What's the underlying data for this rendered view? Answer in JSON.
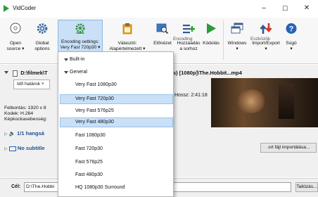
{
  "window": {
    "title": "VidCoder",
    "minimize": "–",
    "maximize": "☐",
    "close": "✕"
  },
  "ribbon": {
    "open_source": [
      "Open",
      "source"
    ],
    "global_options": [
      "Global",
      "options"
    ],
    "encoding_settings": [
      "Encoding settings:",
      "Very Fast 720p30"
    ],
    "picker": [
      "Választó:",
      "Alapértelmezett"
    ],
    "preview": "Előnézet",
    "add_to_queue": [
      "Hozzáadás",
      "a sorhoz"
    ],
    "encode": "Kódolás",
    "windows": "Windows",
    "import_export": "Import/Export",
    "help": "Súgó",
    "group_encoding": "Encoding",
    "group_tools": "Eszközök"
  },
  "source": {
    "path_left": "D:\\filmek\\T",
    "path_right": "s) [1080p]\\The.Hobbit...mp4",
    "titles_dropdown": "Idő határok",
    "length_label": "Hossz:",
    "length_value": "2:41:18",
    "resolution": "Felbontás: 1920 x 8",
    "codec": "Kodek: H.264",
    "framerate": "Képkockasebesség:",
    "audio": "1/1 hangsá",
    "subtitles": "No subtitle",
    "srt_button": ".srt fájl importálása..."
  },
  "destination": {
    "label": "Cél:",
    "value": "D:\\The.Hobbi",
    "browse": "Tallózás..."
  },
  "dropdown": {
    "built_in": "Built-in",
    "general": "General",
    "presets": [
      "Very Fast 1080p30",
      "Very Fast 720p30",
      "Very Fast 576p25",
      "Very Fast 480p30",
      "Fast 1080p30",
      "Fast 720p30",
      "Fast 576p25",
      "Fast 480p30",
      "HQ 1080p30 Surround"
    ]
  },
  "colors": {
    "accent": "#2a9d3c",
    "selection": "#c9e0f7",
    "link_blue": "#1e5fb3"
  }
}
